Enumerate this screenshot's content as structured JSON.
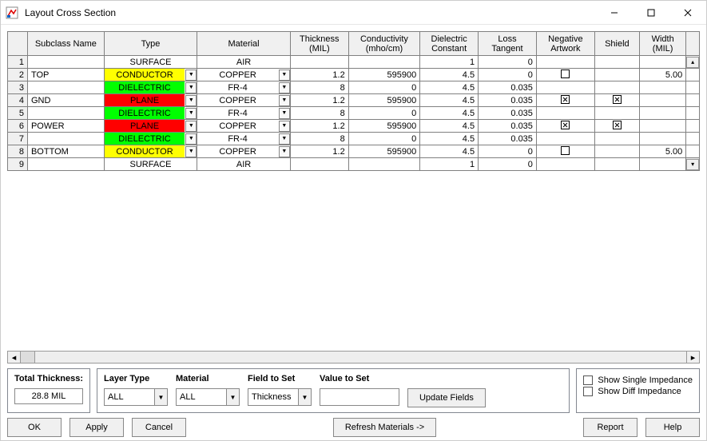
{
  "window": {
    "title": "Layout Cross Section"
  },
  "headers": {
    "c0": "",
    "c1": "Subclass Name",
    "c2": "Type",
    "c3": "Material",
    "c4": "Thickness\n(MIL)",
    "c5": "Conductivity\n(mho/cm)",
    "c6": "Dielectric\nConstant",
    "c7": "Loss\nTangent",
    "c8": "Negative\nArtwork",
    "c9": "Shield",
    "c10": "Width\n(MIL)"
  },
  "rows": [
    {
      "n": "1",
      "sub": "",
      "type": "SURFACE",
      "typecolor": "",
      "mat": "AIR",
      "matdd": false,
      "th": "",
      "cond": "",
      "dc": "1",
      "lt": "0",
      "na": "",
      "sh": "",
      "w": ""
    },
    {
      "n": "2",
      "sub": "TOP",
      "type": "CONDUCTOR",
      "typecolor": "yellow",
      "mat": "COPPER",
      "matdd": true,
      "th": "1.2",
      "cond": "595900",
      "dc": "4.5",
      "lt": "0",
      "na": "empty",
      "sh": "",
      "w": "5.00"
    },
    {
      "n": "3",
      "sub": "",
      "type": "DIELECTRIC",
      "typecolor": "green",
      "mat": "FR-4",
      "matdd": true,
      "th": "8",
      "cond": "0",
      "dc": "4.5",
      "lt": "0.035",
      "na": "",
      "sh": "",
      "w": ""
    },
    {
      "n": "4",
      "sub": "GND",
      "type": "PLANE",
      "typecolor": "red",
      "mat": "COPPER",
      "matdd": true,
      "th": "1.2",
      "cond": "595900",
      "dc": "4.5",
      "lt": "0.035",
      "na": "x",
      "sh": "x",
      "w": ""
    },
    {
      "n": "5",
      "sub": "",
      "type": "DIELECTRIC",
      "typecolor": "green",
      "mat": "FR-4",
      "matdd": true,
      "th": "8",
      "cond": "0",
      "dc": "4.5",
      "lt": "0.035",
      "na": "",
      "sh": "",
      "w": ""
    },
    {
      "n": "6",
      "sub": "POWER",
      "type": "PLANE",
      "typecolor": "red",
      "mat": "COPPER",
      "matdd": true,
      "th": "1.2",
      "cond": "595900",
      "dc": "4.5",
      "lt": "0.035",
      "na": "x",
      "sh": "x",
      "w": ""
    },
    {
      "n": "7",
      "sub": "",
      "type": "DIELECTRIC",
      "typecolor": "green",
      "mat": "FR-4",
      "matdd": true,
      "th": "8",
      "cond": "0",
      "dc": "4.5",
      "lt": "0.035",
      "na": "",
      "sh": "",
      "w": ""
    },
    {
      "n": "8",
      "sub": "BOTTOM",
      "type": "CONDUCTOR",
      "typecolor": "yellow",
      "mat": "COPPER",
      "matdd": true,
      "th": "1.2",
      "cond": "595900",
      "dc": "4.5",
      "lt": "0",
      "na": "empty",
      "sh": "",
      "w": "5.00"
    },
    {
      "n": "9",
      "sub": "",
      "type": "SURFACE",
      "typecolor": "",
      "mat": "AIR",
      "matdd": false,
      "th": "",
      "cond": "",
      "dc": "1",
      "lt": "0",
      "na": "",
      "sh": "",
      "w": ""
    }
  ],
  "footer": {
    "total_thickness_label": "Total Thickness:",
    "total_thickness_value": "28.8 MIL",
    "layer_type_label": "Layer Type",
    "layer_type_value": "ALL",
    "material_label": "Material",
    "material_value": "ALL",
    "field_to_set_label": "Field to Set",
    "field_to_set_value": "Thickness",
    "value_to_set_label": "Value to Set",
    "value_to_set_value": "",
    "update_fields": "Update Fields",
    "show_single": "Show Single Impedance",
    "show_diff": "Show Diff Impedance"
  },
  "buttons": {
    "ok": "OK",
    "apply": "Apply",
    "cancel": "Cancel",
    "refresh": "Refresh Materials ->",
    "report": "Report",
    "help": "Help"
  }
}
